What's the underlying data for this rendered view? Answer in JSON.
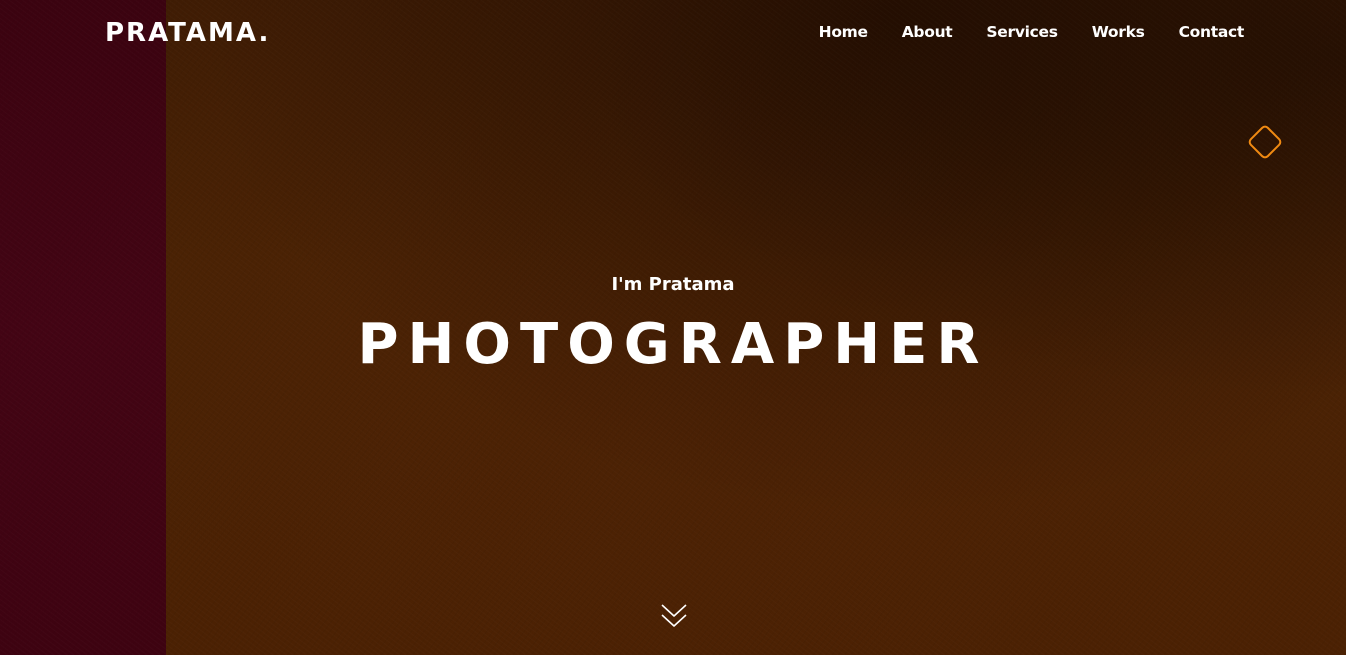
{
  "brand": {
    "logo": "PRATAMA."
  },
  "nav": {
    "items": [
      {
        "label": "Home"
      },
      {
        "label": "About"
      },
      {
        "label": "Services"
      },
      {
        "label": "Works"
      },
      {
        "label": "Contact"
      }
    ]
  },
  "hero": {
    "intro": "I'm Pratama",
    "title": "PHOTOGRAPHER",
    "scroll_icon": "chevron-double-down-icon",
    "deco_icon": "diamond-outline-icon"
  },
  "colors": {
    "background": "#4a2204",
    "left_strip": "#420414",
    "accent": "#f08a12",
    "text": "#ffffff"
  }
}
